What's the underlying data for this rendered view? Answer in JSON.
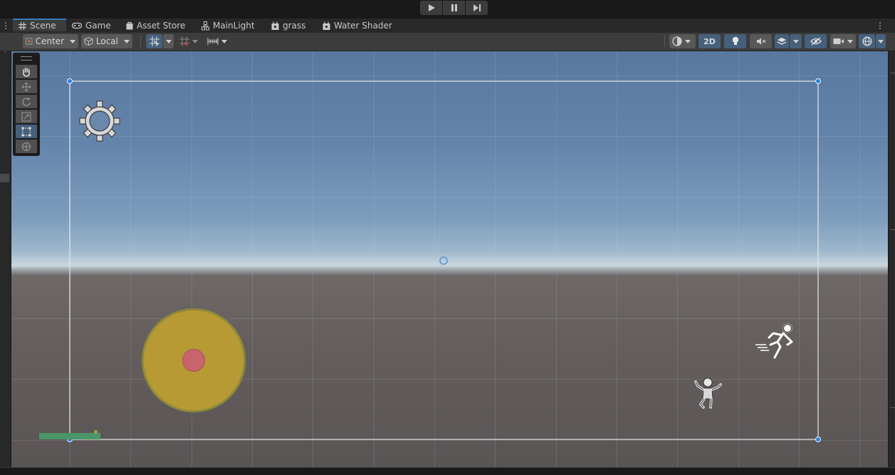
{
  "tabs": [
    {
      "label": "Scene",
      "icon": "grid-icon"
    },
    {
      "label": "Game",
      "icon": "gamepad-icon"
    },
    {
      "label": "Asset Store",
      "icon": "store-bag-icon"
    },
    {
      "label": "MainLight",
      "icon": "gameobject-icon"
    },
    {
      "label": "grass",
      "icon": "prefab-icon"
    },
    {
      "label": "Water Shader",
      "icon": "shader-icon"
    }
  ],
  "toolbar": {
    "pivot_label": "Center",
    "space_label": "Local",
    "mode_2d_label": "2D"
  },
  "playmode": {
    "play": "play-icon",
    "pause": "pause-icon",
    "step": "step-icon"
  },
  "colors": {
    "accent": "#3a79bb",
    "selected_tool": "#46607c",
    "sun_disc": "#b89a34",
    "sun_core": "#c8646e",
    "ground_strip": "#4b9668",
    "handle": "#2f80e0"
  }
}
